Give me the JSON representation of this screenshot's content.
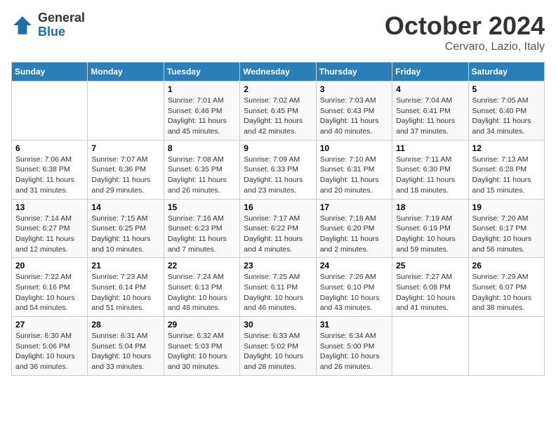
{
  "header": {
    "logo_general": "General",
    "logo_blue": "Blue",
    "month": "October 2024",
    "location": "Cervaro, Lazio, Italy"
  },
  "days_of_week": [
    "Sunday",
    "Monday",
    "Tuesday",
    "Wednesday",
    "Thursday",
    "Friday",
    "Saturday"
  ],
  "weeks": [
    [
      {
        "day": "",
        "info": ""
      },
      {
        "day": "",
        "info": ""
      },
      {
        "day": "1",
        "info": "Sunrise: 7:01 AM\nSunset: 6:46 PM\nDaylight: 11 hours and 45 minutes."
      },
      {
        "day": "2",
        "info": "Sunrise: 7:02 AM\nSunset: 6:45 PM\nDaylight: 11 hours and 42 minutes."
      },
      {
        "day": "3",
        "info": "Sunrise: 7:03 AM\nSunset: 6:43 PM\nDaylight: 11 hours and 40 minutes."
      },
      {
        "day": "4",
        "info": "Sunrise: 7:04 AM\nSunset: 6:41 PM\nDaylight: 11 hours and 37 minutes."
      },
      {
        "day": "5",
        "info": "Sunrise: 7:05 AM\nSunset: 6:40 PM\nDaylight: 11 hours and 34 minutes."
      }
    ],
    [
      {
        "day": "6",
        "info": "Sunrise: 7:06 AM\nSunset: 6:38 PM\nDaylight: 11 hours and 31 minutes."
      },
      {
        "day": "7",
        "info": "Sunrise: 7:07 AM\nSunset: 6:36 PM\nDaylight: 11 hours and 29 minutes."
      },
      {
        "day": "8",
        "info": "Sunrise: 7:08 AM\nSunset: 6:35 PM\nDaylight: 11 hours and 26 minutes."
      },
      {
        "day": "9",
        "info": "Sunrise: 7:09 AM\nSunset: 6:33 PM\nDaylight: 11 hours and 23 minutes."
      },
      {
        "day": "10",
        "info": "Sunrise: 7:10 AM\nSunset: 6:31 PM\nDaylight: 11 hours and 20 minutes."
      },
      {
        "day": "11",
        "info": "Sunrise: 7:11 AM\nSunset: 6:30 PM\nDaylight: 11 hours and 18 minutes."
      },
      {
        "day": "12",
        "info": "Sunrise: 7:13 AM\nSunset: 6:28 PM\nDaylight: 11 hours and 15 minutes."
      }
    ],
    [
      {
        "day": "13",
        "info": "Sunrise: 7:14 AM\nSunset: 6:27 PM\nDaylight: 11 hours and 12 minutes."
      },
      {
        "day": "14",
        "info": "Sunrise: 7:15 AM\nSunset: 6:25 PM\nDaylight: 11 hours and 10 minutes."
      },
      {
        "day": "15",
        "info": "Sunrise: 7:16 AM\nSunset: 6:23 PM\nDaylight: 11 hours and 7 minutes."
      },
      {
        "day": "16",
        "info": "Sunrise: 7:17 AM\nSunset: 6:22 PM\nDaylight: 11 hours and 4 minutes."
      },
      {
        "day": "17",
        "info": "Sunrise: 7:18 AM\nSunset: 6:20 PM\nDaylight: 11 hours and 2 minutes."
      },
      {
        "day": "18",
        "info": "Sunrise: 7:19 AM\nSunset: 6:19 PM\nDaylight: 10 hours and 59 minutes."
      },
      {
        "day": "19",
        "info": "Sunrise: 7:20 AM\nSunset: 6:17 PM\nDaylight: 10 hours and 56 minutes."
      }
    ],
    [
      {
        "day": "20",
        "info": "Sunrise: 7:22 AM\nSunset: 6:16 PM\nDaylight: 10 hours and 54 minutes."
      },
      {
        "day": "21",
        "info": "Sunrise: 7:23 AM\nSunset: 6:14 PM\nDaylight: 10 hours and 51 minutes."
      },
      {
        "day": "22",
        "info": "Sunrise: 7:24 AM\nSunset: 6:13 PM\nDaylight: 10 hours and 48 minutes."
      },
      {
        "day": "23",
        "info": "Sunrise: 7:25 AM\nSunset: 6:11 PM\nDaylight: 10 hours and 46 minutes."
      },
      {
        "day": "24",
        "info": "Sunrise: 7:26 AM\nSunset: 6:10 PM\nDaylight: 10 hours and 43 minutes."
      },
      {
        "day": "25",
        "info": "Sunrise: 7:27 AM\nSunset: 6:08 PM\nDaylight: 10 hours and 41 minutes."
      },
      {
        "day": "26",
        "info": "Sunrise: 7:29 AM\nSunset: 6:07 PM\nDaylight: 10 hours and 38 minutes."
      }
    ],
    [
      {
        "day": "27",
        "info": "Sunrise: 6:30 AM\nSunset: 5:06 PM\nDaylight: 10 hours and 36 minutes."
      },
      {
        "day": "28",
        "info": "Sunrise: 6:31 AM\nSunset: 5:04 PM\nDaylight: 10 hours and 33 minutes."
      },
      {
        "day": "29",
        "info": "Sunrise: 6:32 AM\nSunset: 5:03 PM\nDaylight: 10 hours and 30 minutes."
      },
      {
        "day": "30",
        "info": "Sunrise: 6:33 AM\nSunset: 5:02 PM\nDaylight: 10 hours and 28 minutes."
      },
      {
        "day": "31",
        "info": "Sunrise: 6:34 AM\nSunset: 5:00 PM\nDaylight: 10 hours and 26 minutes."
      },
      {
        "day": "",
        "info": ""
      },
      {
        "day": "",
        "info": ""
      }
    ]
  ]
}
